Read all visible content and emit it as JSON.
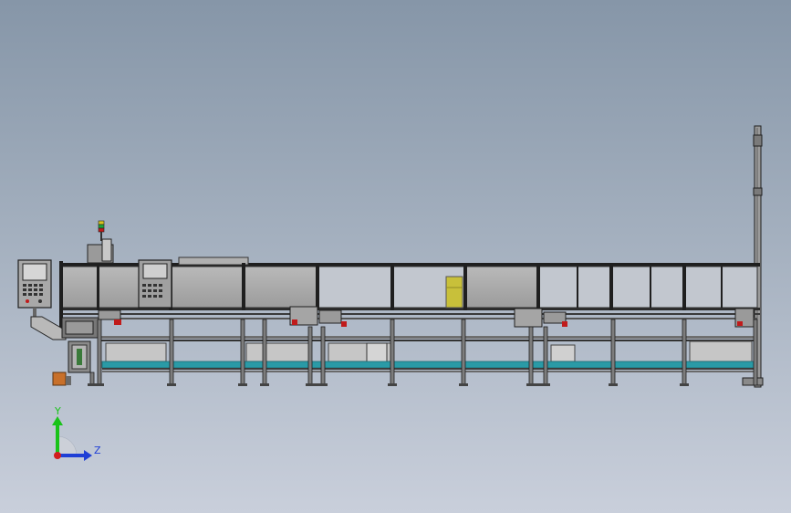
{
  "triad": {
    "y_label": "Y",
    "z_label": "Z",
    "y_color": "#19c319",
    "z_color": "#1f3fd6",
    "origin_color": "#d21d1d"
  },
  "colors": {
    "background_top": "#8696a8",
    "background_bottom": "#c9cfdb",
    "frame": "#1f1f1f",
    "panel": "#a9a9a9",
    "conveyor_belt": "#2a9aa6",
    "box": "#c8c03a",
    "accent_red": "#c01b1b",
    "accent_orange": "#c8702a"
  },
  "components": [
    "control-panel",
    "signal-tower",
    "hmi-panel",
    "enclosure-frame",
    "conveyor-belt",
    "support-legs",
    "cylinder-assemblies",
    "feed-chute",
    "right-mast",
    "product-box"
  ]
}
